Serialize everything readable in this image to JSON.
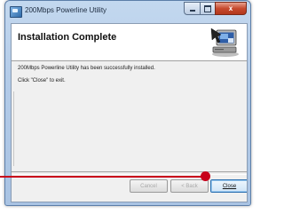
{
  "window": {
    "title": "200Mbps Powerline Utility",
    "close_glyph": "x",
    "app_icon": "powerline-app-icon"
  },
  "header": {
    "title": "Installation Complete",
    "icon": "computer-install-icon"
  },
  "body": {
    "message1": "200Mbps Powerline Utility has been successfully installed.",
    "message2": "Click \"Close\" to exit."
  },
  "buttons": {
    "cancel": "Cancel",
    "back": "< Back",
    "close": "Close"
  },
  "annotation": {
    "color": "#c8001a",
    "target": "close-button"
  }
}
